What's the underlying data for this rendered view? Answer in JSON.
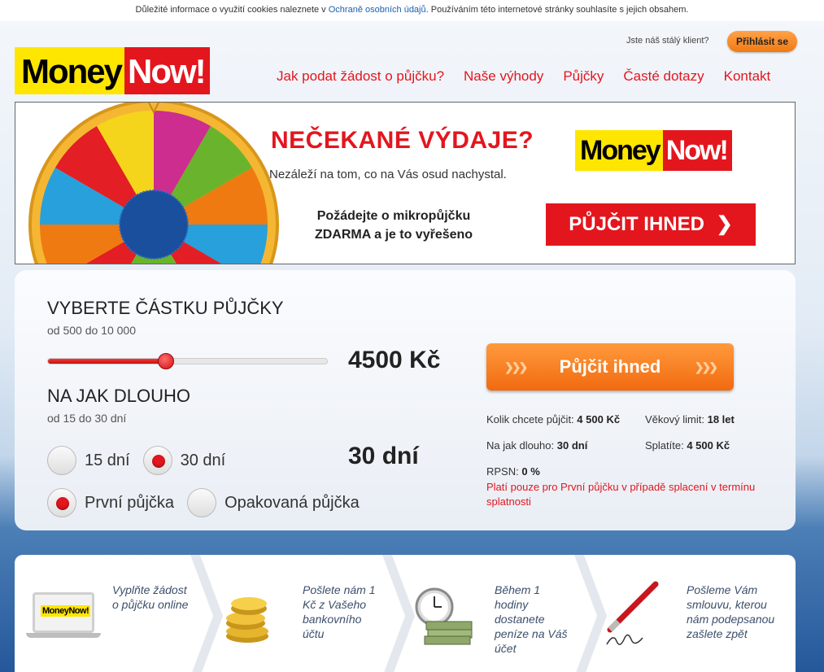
{
  "cookie": {
    "text_before": "Důležité informace o využití cookies naleznete v ",
    "link": "Ochraně osobních údajů",
    "text_after": ". Používáním této internetové stránky souhlasíte s jejich obsahem."
  },
  "header": {
    "login_question": "Jste náš stálý klient?",
    "login_button": "Přihlásit se",
    "logo_money": "Money",
    "logo_now": "Now!",
    "nav": [
      "Jak podat žádost o půjčku?",
      "Naše výhody",
      "Půjčky",
      "Časté dotazy",
      "Kontakt"
    ]
  },
  "banner": {
    "title": "NEČEKANÉ VÝDAJE?",
    "subtitle": "Nezáleží na tom, co na Vás osud nachystal.",
    "note_line1": "Požádejte o mikropůjčku",
    "note_line2": "ZDARMA a je to vyřešeno",
    "logo_money": "Money",
    "logo_now": "Now!",
    "button": "PŮJČIT IHNED"
  },
  "calculator": {
    "amount_heading": "VYBERTE ČÁSTKU PŮJČKY",
    "amount_range": "od 500 do 10 000",
    "amount_value": "4500 Kč",
    "amount_slider_fraction": 0.42,
    "duration_heading": "NA JAK DLOUHO",
    "duration_range": "od 15 do 30 dní",
    "duration_value": "30 dní",
    "duration_options": [
      {
        "label": "15 dní",
        "selected": false
      },
      {
        "label": "30 dní",
        "selected": true
      }
    ],
    "loan_type_options": [
      {
        "label": "První půjčka",
        "selected": true
      },
      {
        "label": "Opakovaná půjčka",
        "selected": false
      }
    ],
    "cta": "Půjčit ihned",
    "summary": {
      "want_label": "Kolik chcete půjčit:",
      "want_value": "4 500 Kč",
      "age_label": "Věkový limit:",
      "age_value": "18 let",
      "duration_label": "Na jak dlouho:",
      "duration_value": "30 dní",
      "repay_label": "Splatíte:",
      "repay_value": "4 500 Kč",
      "rpsn_label": "RPSN:",
      "rpsn_value": "0 %",
      "note": "Platí pouze pro První půjčku v případě splacení v termínu splatnosti"
    }
  },
  "steps": [
    {
      "text": "Vyplňte žádost o půjčku online",
      "icon": "laptop-icon",
      "laptop_logo": "MoneyNow!"
    },
    {
      "text": "Pošlete nám 1 Kč z Vašeho bankovního účtu",
      "icon": "coins-icon"
    },
    {
      "text": "Během 1 hodiny dostanete peníze na Váš účet",
      "icon": "clock-money-icon"
    },
    {
      "text": "Pošleme Vám smlouvu, kterou nám podepsanou zašlete zpět",
      "icon": "pen-signature-icon"
    }
  ],
  "colors": {
    "brand_red": "#e3161e",
    "brand_yellow": "#ffe600",
    "cta_orange": "#f26a10"
  }
}
